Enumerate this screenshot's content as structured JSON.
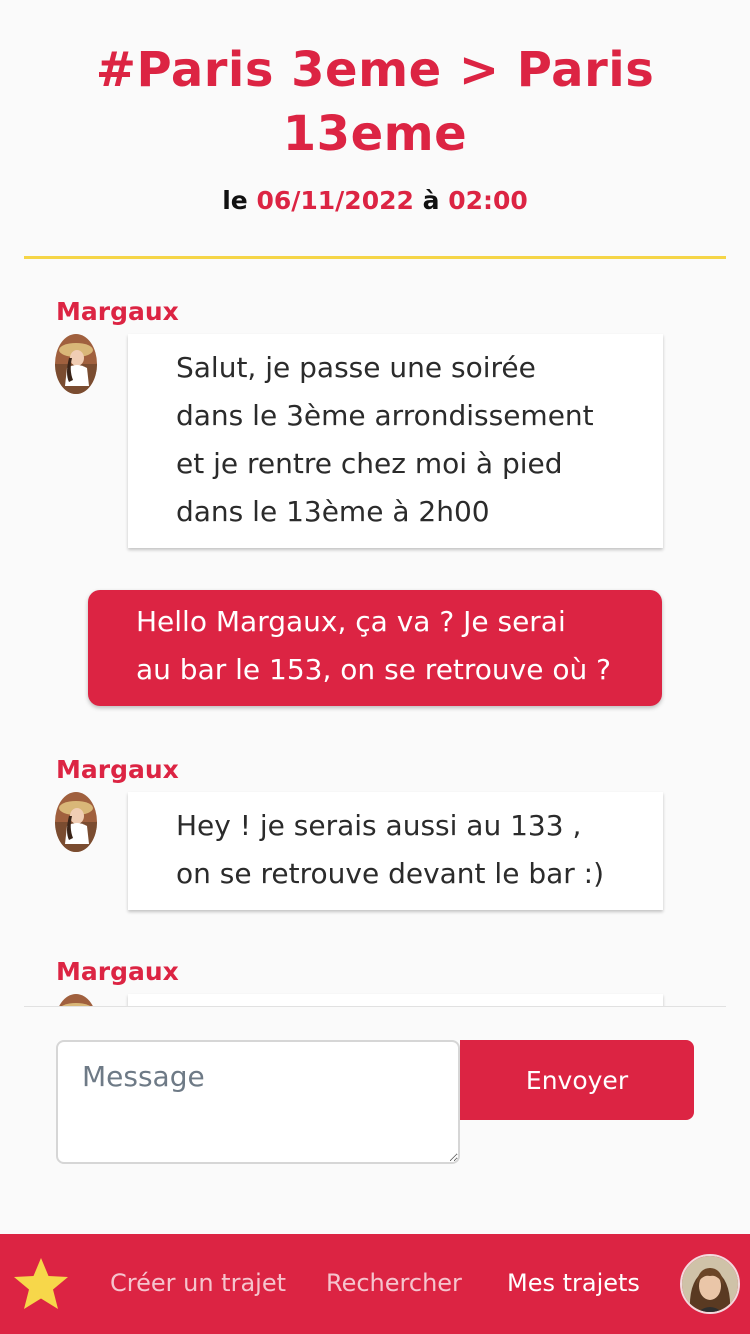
{
  "header": {
    "title": "#Paris 3eme > Paris 13eme",
    "date_prefix": "le",
    "date": "06/11/2022",
    "time_prefix": "à",
    "time": "02:00"
  },
  "colors": {
    "accent": "#dc2443",
    "divider": "#f5d547"
  },
  "messages": [
    {
      "direction": "incoming",
      "sender": "Margaux",
      "lines": [
        "Salut, je passe une soirée",
        "dans le 3ème arrondissement",
        "et je rentre chez moi à pied",
        "dans le 13ème à 2h00"
      ]
    },
    {
      "direction": "outgoing",
      "lines": [
        "Hello Margaux, ça va ? Je serai",
        "au bar le 153, on se retrouve où ?"
      ]
    },
    {
      "direction": "incoming",
      "sender": "Margaux",
      "lines": [
        "Hey ! je serais aussi au 133 ,",
        "on se retrouve devant le bar :)"
      ]
    },
    {
      "direction": "incoming",
      "sender": "Margaux",
      "lines": []
    }
  ],
  "composer": {
    "placeholder": "Message",
    "send_label": "Envoyer"
  },
  "nav": {
    "favorite_icon": "star-icon",
    "create_label": "Créer un trajet",
    "search_label": "Rechercher",
    "my_trips_label": "Mes trajets",
    "active": "my_trips",
    "profile_icon": "avatar"
  }
}
